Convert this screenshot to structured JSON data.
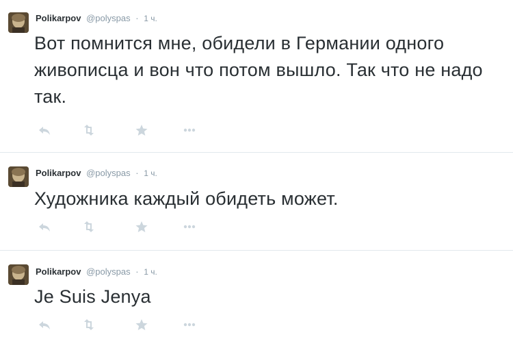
{
  "colors": {
    "text": "#292f33",
    "muted": "#8899a6",
    "icon": "#ccd6dd",
    "divider": "#e1e8ed"
  },
  "tweets": [
    {
      "fullname": "Polikarpov",
      "username": "@polyspas",
      "separator": "·",
      "time": "1 ч.",
      "text": "Вот помнится мне, обидели в Германии одного живописца и вон что потом вышло. Так что не надо так.",
      "actions": [
        "reply-icon",
        "retweet-icon",
        "favorite-icon",
        "more-icon"
      ]
    },
    {
      "fullname": "Polikarpov",
      "username": "@polyspas",
      "separator": "·",
      "time": "1 ч.",
      "text": "Художника каждый обидеть может.",
      "actions": [
        "reply-icon",
        "retweet-icon",
        "favorite-icon",
        "more-icon"
      ]
    },
    {
      "fullname": "Polikarpov",
      "username": "@polyspas",
      "separator": "·",
      "time": "1 ч.",
      "text": "Je Suis Jenya",
      "actions": [
        "reply-icon",
        "retweet-icon",
        "favorite-icon",
        "more-icon"
      ]
    }
  ]
}
